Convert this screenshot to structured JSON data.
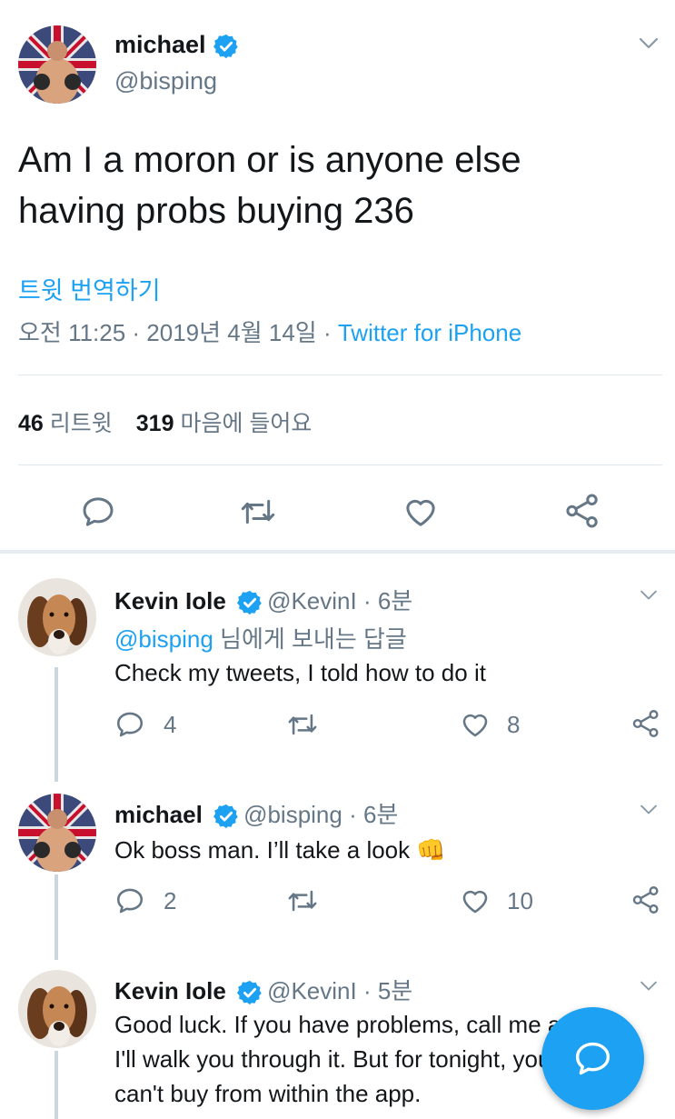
{
  "main_tweet": {
    "name": "michael",
    "handle": "@bisping",
    "text_line1": "Am I a moron or is anyone else",
    "text_line2": "having probs buying 236",
    "translate": "트윗 번역하기",
    "meta_time": "오전 11:25 · 2019년 4월 14일 · ",
    "meta_source": "Twitter for iPhone",
    "retweet_count": "46",
    "retweet_label": "리트윗",
    "like_count": "319",
    "like_label": "마음에 들어요"
  },
  "replies": [
    {
      "name": "Kevin Iole",
      "handle": "@KevinI",
      "time": " · 6분",
      "reply_to": "@bisping",
      "reply_to_suffix": " 님에게 보내는 답글",
      "text": "Check my tweets, I told how to do it",
      "replies": "4",
      "likes": "8"
    },
    {
      "name": "michael",
      "handle": "@bisping",
      "time": " · 6분",
      "text": "Ok boss man. I’ll take a look",
      "emoji": "👊",
      "replies": "2",
      "likes": "10"
    },
    {
      "name": "Kevin Iole",
      "handle": "@KevinI",
      "time": " · 5분",
      "text_line1": "Good luck. If you have problems, call me and",
      "text_line2": "I'll walk you through it. But for tonight, you",
      "text_line3": "can't buy from within the app."
    }
  ],
  "colors": {
    "accent": "#1da1f2",
    "text": "#14171a",
    "secondary": "#657786",
    "divider": "#e1e8ed"
  },
  "icons": [
    "verified-badge-icon",
    "chevron-down-icon",
    "reply-icon",
    "retweet-icon",
    "like-icon",
    "share-icon",
    "compose-icon"
  ]
}
